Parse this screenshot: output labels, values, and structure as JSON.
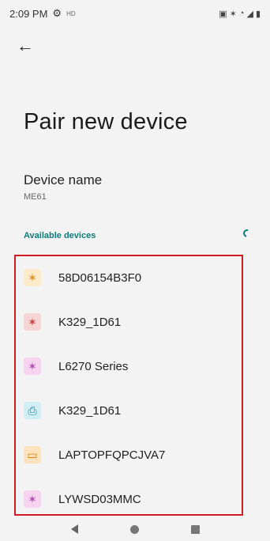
{
  "status_bar": {
    "time": "2:09 PM",
    "left_icons": [
      "gear-icon",
      "hd-icon"
    ],
    "hd_label": "HD",
    "right_icons": [
      "screenshot-icon",
      "bluetooth-icon",
      "wifi-icon",
      "signal-icon",
      "battery-icon"
    ]
  },
  "header": {
    "back_icon": "arrow-left-icon"
  },
  "page": {
    "title": "Pair new device",
    "device_name_label": "Device name",
    "device_name_value": "ME61",
    "available_label": "Available devices"
  },
  "devices": [
    {
      "label": "58D06154B3F0",
      "icon": "bluetooth-icon",
      "glyph": "✶",
      "bg": "#fdeacb",
      "fg": "#e0902a"
    },
    {
      "label": "K329_1D61",
      "icon": "bluetooth-icon",
      "glyph": "✶",
      "bg": "#f8d5d5",
      "fg": "#c94040"
    },
    {
      "label": "L6270 Series",
      "icon": "bluetooth-icon",
      "glyph": "✶",
      "bg": "#f6d4ef",
      "fg": "#b24cb0"
    },
    {
      "label": "K329_1D61",
      "icon": "printer-icon",
      "glyph": "⎙",
      "bg": "#d1eef4",
      "fg": "#1f8aa4"
    },
    {
      "label": "LAPTOPFQPCJVA7",
      "icon": "laptop-icon",
      "glyph": "▭",
      "bg": "#fde3bd",
      "fg": "#d97f07"
    },
    {
      "label": "LYWSD03MMC",
      "icon": "bluetooth-icon",
      "glyph": "✶",
      "bg": "#f6d4ef",
      "fg": "#b24cb0"
    }
  ],
  "colors": {
    "accent": "#0b7d77",
    "highlight_border": "#d11b25",
    "background": "#f3f3f3"
  },
  "nav_bar": {
    "icons": [
      "back-nav-icon",
      "home-nav-icon",
      "recents-nav-icon"
    ]
  }
}
